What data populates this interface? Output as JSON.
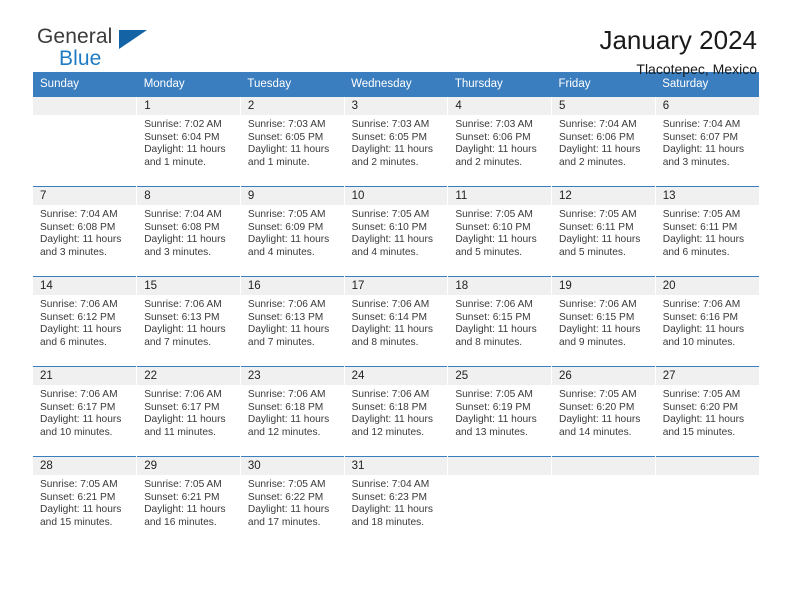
{
  "brand": {
    "name_part1": "General",
    "name_part2": "Blue",
    "accent_color": "#1f7cc4",
    "triangle_color": "#1464a5"
  },
  "header": {
    "title": "January 2024",
    "subtitle": "Tlacotepec, Mexico"
  },
  "calendar": {
    "header_bg": "#3a7ebf",
    "daynum_bg": "#f0f0f0",
    "weekdays": [
      "Sunday",
      "Monday",
      "Tuesday",
      "Wednesday",
      "Thursday",
      "Friday",
      "Saturday"
    ],
    "weeks": [
      [
        {
          "day": "",
          "lines": []
        },
        {
          "day": "1",
          "lines": [
            "Sunrise: 7:02 AM",
            "Sunset: 6:04 PM",
            "Daylight: 11 hours",
            "and 1 minute."
          ]
        },
        {
          "day": "2",
          "lines": [
            "Sunrise: 7:03 AM",
            "Sunset: 6:05 PM",
            "Daylight: 11 hours",
            "and 1 minute."
          ]
        },
        {
          "day": "3",
          "lines": [
            "Sunrise: 7:03 AM",
            "Sunset: 6:05 PM",
            "Daylight: 11 hours",
            "and 2 minutes."
          ]
        },
        {
          "day": "4",
          "lines": [
            "Sunrise: 7:03 AM",
            "Sunset: 6:06 PM",
            "Daylight: 11 hours",
            "and 2 minutes."
          ]
        },
        {
          "day": "5",
          "lines": [
            "Sunrise: 7:04 AM",
            "Sunset: 6:06 PM",
            "Daylight: 11 hours",
            "and 2 minutes."
          ]
        },
        {
          "day": "6",
          "lines": [
            "Sunrise: 7:04 AM",
            "Sunset: 6:07 PM",
            "Daylight: 11 hours",
            "and 3 minutes."
          ]
        }
      ],
      [
        {
          "day": "7",
          "lines": [
            "Sunrise: 7:04 AM",
            "Sunset: 6:08 PM",
            "Daylight: 11 hours",
            "and 3 minutes."
          ]
        },
        {
          "day": "8",
          "lines": [
            "Sunrise: 7:04 AM",
            "Sunset: 6:08 PM",
            "Daylight: 11 hours",
            "and 3 minutes."
          ]
        },
        {
          "day": "9",
          "lines": [
            "Sunrise: 7:05 AM",
            "Sunset: 6:09 PM",
            "Daylight: 11 hours",
            "and 4 minutes."
          ]
        },
        {
          "day": "10",
          "lines": [
            "Sunrise: 7:05 AM",
            "Sunset: 6:10 PM",
            "Daylight: 11 hours",
            "and 4 minutes."
          ]
        },
        {
          "day": "11",
          "lines": [
            "Sunrise: 7:05 AM",
            "Sunset: 6:10 PM",
            "Daylight: 11 hours",
            "and 5 minutes."
          ]
        },
        {
          "day": "12",
          "lines": [
            "Sunrise: 7:05 AM",
            "Sunset: 6:11 PM",
            "Daylight: 11 hours",
            "and 5 minutes."
          ]
        },
        {
          "day": "13",
          "lines": [
            "Sunrise: 7:05 AM",
            "Sunset: 6:11 PM",
            "Daylight: 11 hours",
            "and 6 minutes."
          ]
        }
      ],
      [
        {
          "day": "14",
          "lines": [
            "Sunrise: 7:06 AM",
            "Sunset: 6:12 PM",
            "Daylight: 11 hours",
            "and 6 minutes."
          ]
        },
        {
          "day": "15",
          "lines": [
            "Sunrise: 7:06 AM",
            "Sunset: 6:13 PM",
            "Daylight: 11 hours",
            "and 7 minutes."
          ]
        },
        {
          "day": "16",
          "lines": [
            "Sunrise: 7:06 AM",
            "Sunset: 6:13 PM",
            "Daylight: 11 hours",
            "and 7 minutes."
          ]
        },
        {
          "day": "17",
          "lines": [
            "Sunrise: 7:06 AM",
            "Sunset: 6:14 PM",
            "Daylight: 11 hours",
            "and 8 minutes."
          ]
        },
        {
          "day": "18",
          "lines": [
            "Sunrise: 7:06 AM",
            "Sunset: 6:15 PM",
            "Daylight: 11 hours",
            "and 8 minutes."
          ]
        },
        {
          "day": "19",
          "lines": [
            "Sunrise: 7:06 AM",
            "Sunset: 6:15 PM",
            "Daylight: 11 hours",
            "and 9 minutes."
          ]
        },
        {
          "day": "20",
          "lines": [
            "Sunrise: 7:06 AM",
            "Sunset: 6:16 PM",
            "Daylight: 11 hours",
            "and 10 minutes."
          ]
        }
      ],
      [
        {
          "day": "21",
          "lines": [
            "Sunrise: 7:06 AM",
            "Sunset: 6:17 PM",
            "Daylight: 11 hours",
            "and 10 minutes."
          ]
        },
        {
          "day": "22",
          "lines": [
            "Sunrise: 7:06 AM",
            "Sunset: 6:17 PM",
            "Daylight: 11 hours",
            "and 11 minutes."
          ]
        },
        {
          "day": "23",
          "lines": [
            "Sunrise: 7:06 AM",
            "Sunset: 6:18 PM",
            "Daylight: 11 hours",
            "and 12 minutes."
          ]
        },
        {
          "day": "24",
          "lines": [
            "Sunrise: 7:06 AM",
            "Sunset: 6:18 PM",
            "Daylight: 11 hours",
            "and 12 minutes."
          ]
        },
        {
          "day": "25",
          "lines": [
            "Sunrise: 7:05 AM",
            "Sunset: 6:19 PM",
            "Daylight: 11 hours",
            "and 13 minutes."
          ]
        },
        {
          "day": "26",
          "lines": [
            "Sunrise: 7:05 AM",
            "Sunset: 6:20 PM",
            "Daylight: 11 hours",
            "and 14 minutes."
          ]
        },
        {
          "day": "27",
          "lines": [
            "Sunrise: 7:05 AM",
            "Sunset: 6:20 PM",
            "Daylight: 11 hours",
            "and 15 minutes."
          ]
        }
      ],
      [
        {
          "day": "28",
          "lines": [
            "Sunrise: 7:05 AM",
            "Sunset: 6:21 PM",
            "Daylight: 11 hours",
            "and 15 minutes."
          ]
        },
        {
          "day": "29",
          "lines": [
            "Sunrise: 7:05 AM",
            "Sunset: 6:21 PM",
            "Daylight: 11 hours",
            "and 16 minutes."
          ]
        },
        {
          "day": "30",
          "lines": [
            "Sunrise: 7:05 AM",
            "Sunset: 6:22 PM",
            "Daylight: 11 hours",
            "and 17 minutes."
          ]
        },
        {
          "day": "31",
          "lines": [
            "Sunrise: 7:04 AM",
            "Sunset: 6:23 PM",
            "Daylight: 11 hours",
            "and 18 minutes."
          ]
        },
        {
          "day": "",
          "lines": []
        },
        {
          "day": "",
          "lines": []
        },
        {
          "day": "",
          "lines": []
        }
      ]
    ]
  }
}
